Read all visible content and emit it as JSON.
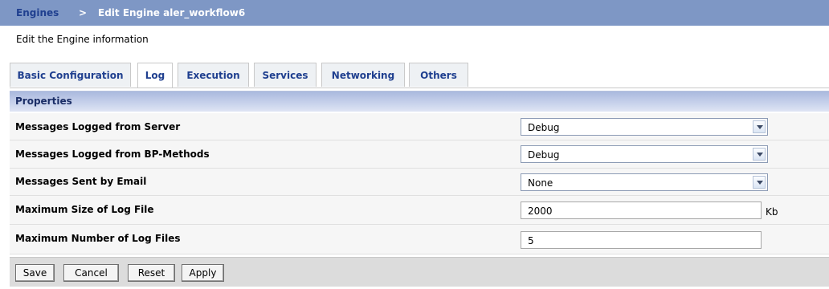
{
  "breadcrumb": {
    "root": "Engines",
    "separator": ">",
    "current": "Edit Engine aler_workflow6"
  },
  "subtitle": "Edit the Engine information",
  "tabs": [
    {
      "label": "Basic Configuration",
      "active": false
    },
    {
      "label": "Log",
      "active": true
    },
    {
      "label": "Execution",
      "active": false
    },
    {
      "label": "Services",
      "active": false
    },
    {
      "label": "Networking",
      "active": false
    },
    {
      "label": "Others",
      "active": false
    }
  ],
  "section_title": "Properties",
  "fields": {
    "server_messages": {
      "label": "Messages Logged from Server",
      "value": "Debug"
    },
    "bp_messages": {
      "label": "Messages Logged from BP-Methods",
      "value": "Debug"
    },
    "email_messages": {
      "label": "Messages Sent by Email",
      "value": "None"
    },
    "max_size": {
      "label": "Maximum Size of Log File",
      "value": "2000",
      "unit": "Kb"
    },
    "max_files": {
      "label": "Maximum Number of Log Files",
      "value": "5"
    }
  },
  "buttons": {
    "save": "Save",
    "cancel": "Cancel",
    "reset": "Reset",
    "apply": "Apply"
  },
  "colors": {
    "header_bg": "#7e97c5",
    "section_bar": "#c9d3ec",
    "row_bg": "#f6f6f6",
    "footer_bg": "#dcdcdc"
  }
}
